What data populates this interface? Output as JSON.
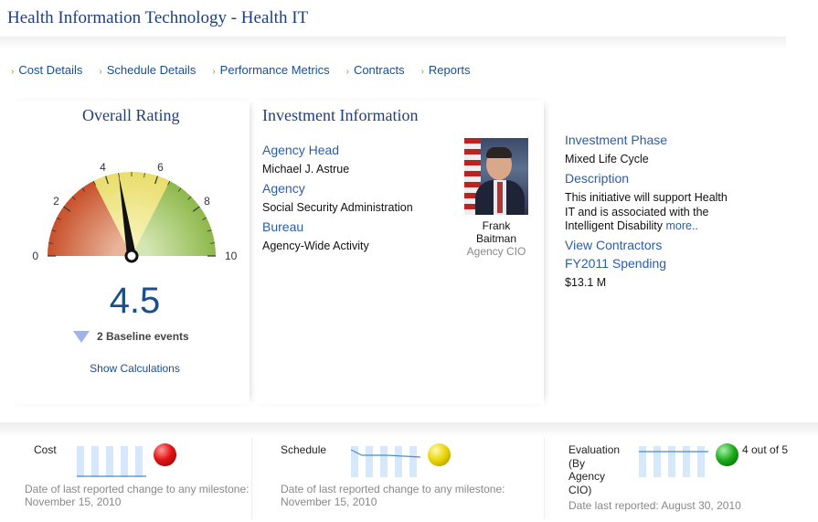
{
  "page": {
    "title": "Health Information Technology - Health IT"
  },
  "nav": [
    {
      "label": "Cost Details"
    },
    {
      "label": "Schedule Details"
    },
    {
      "label": "Performance Metrics"
    },
    {
      "label": "Contracts"
    },
    {
      "label": "Reports"
    }
  ],
  "rating": {
    "heading": "Overall Rating",
    "value": "4.5",
    "needle_value": 4.5,
    "scale_labels": [
      "0",
      "2",
      "4",
      "6",
      "8",
      "10"
    ],
    "baseline_events": "2 Baseline events",
    "show_calculations": "Show Calculations",
    "colors": {
      "red": "#c8502a",
      "yellow": "#e8dd6a",
      "green": "#8db84a"
    }
  },
  "investment": {
    "heading": "Investment Information",
    "agency_head_label": "Agency Head",
    "agency_head": "Michael J. Astrue",
    "agency_label": "Agency",
    "agency": "Social Security Administration",
    "bureau_label": "Bureau",
    "bureau": "Agency-Wide Activity",
    "cio_first": "Frank",
    "cio_last": "Baitman",
    "cio_role": "Agency CIO",
    "phase_label": "Investment Phase",
    "phase": "Mixed Life Cycle",
    "description_label": "Description",
    "description_line1": "This initiative will support Health",
    "description_line2": "IT and is associated with the",
    "description_line3": "Intelligent Disability",
    "more_link": "more..",
    "view_contractors": "View Contractors",
    "spending_label": "FY2011 Spending",
    "spending": "$13.1 M"
  },
  "metrics": {
    "cost": {
      "label": "Cost",
      "status": "red",
      "note_line1": "Date of last reported change to any milestone:",
      "note_line2": "November 15, 2010"
    },
    "schedule": {
      "label": "Schedule",
      "status": "yellow",
      "note_line1": "Date of last reported change to any milestone:",
      "note_line2": "November 15, 2010"
    },
    "evaluation": {
      "label_line1": "Evaluation",
      "label_line2": "(By",
      "label_line3": "Agency",
      "label_line4": "CIO)",
      "status": "green",
      "score": "4 out of 5",
      "note": "Date last reported: August 30, 2010"
    }
  }
}
